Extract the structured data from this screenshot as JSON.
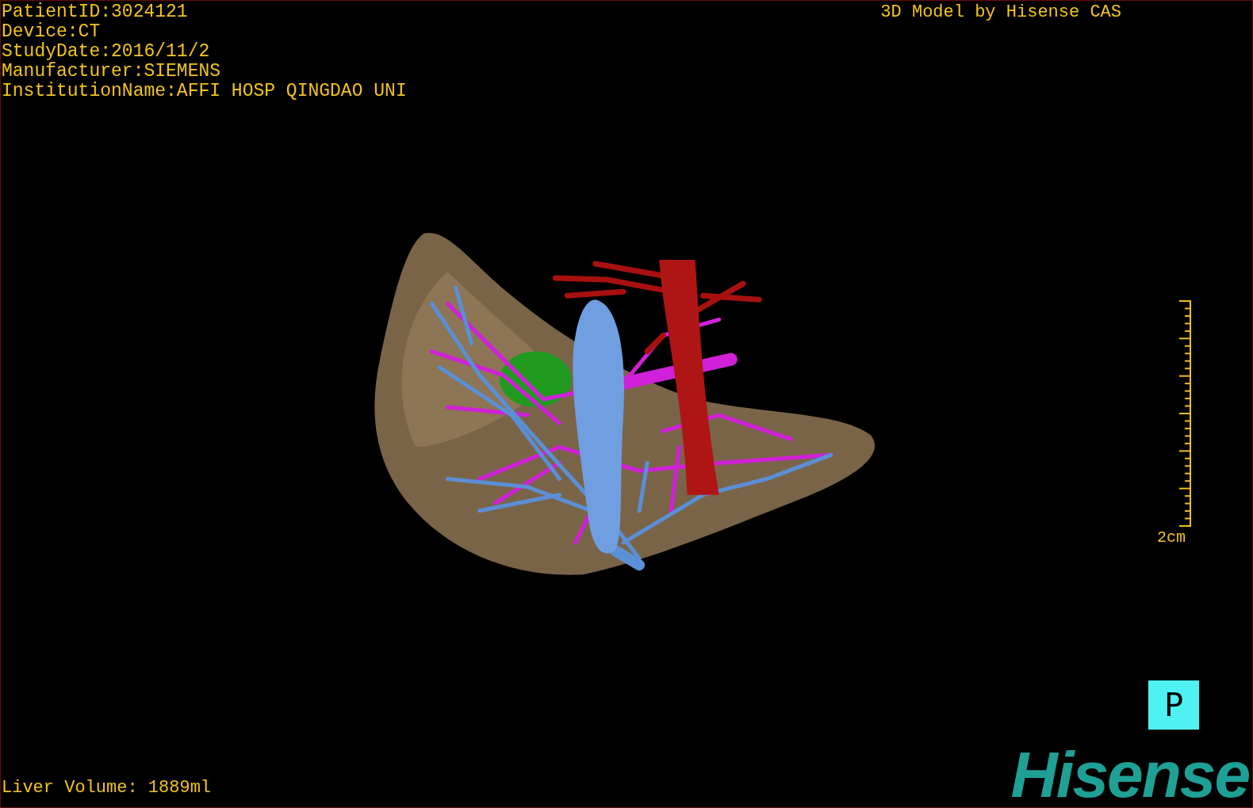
{
  "patient_info": [
    "PatientID:3024121",
    "Device:CT",
    "StudyDate:2016/11/2",
    "Manufacturer:SIEMENS",
    "InstitutionName:AFFI HOSP QINGDAO UNI"
  ],
  "title": "3D Model by Hisense CAS",
  "scale_bar": {
    "label": "2cm"
  },
  "orientation_marker": "P",
  "liver_volume": "Liver Volume: 1889ml",
  "logo": "Hisense"
}
